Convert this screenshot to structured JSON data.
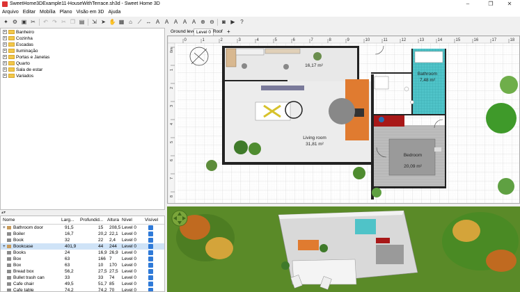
{
  "window": {
    "title": "SweetHome3DExample11-HouseWithTerrace.sh3d - Sweet Home 3D",
    "minimize": "–",
    "maximize": "❐",
    "close": "✕"
  },
  "menu": [
    "Arquivo",
    "Editar",
    "Mobília",
    "Plano",
    "Visão em 3D",
    "Ajuda"
  ],
  "catalog": {
    "categories": [
      "Banheiro",
      "Cozinha",
      "Escadas",
      "Iluminação",
      "Portas e Janelas",
      "Quarto",
      "Sala de estar",
      "Variados"
    ]
  },
  "furniture_table": {
    "columns": [
      "Nome",
      "Larg...",
      "Profundid...",
      "Altura",
      "Nível",
      "Visível"
    ],
    "rows": [
      {
        "name": "Bathroom door",
        "width": "91,5",
        "depth": "15",
        "height": "208,5",
        "level": "Level 0",
        "visible": true,
        "group": true
      },
      {
        "name": "Boiler",
        "width": "16,7",
        "depth": "20,2",
        "height": "22,1",
        "level": "Level 0",
        "visible": true
      },
      {
        "name": "Book",
        "width": "32",
        "depth": "22",
        "height": "2,4",
        "level": "Level 0",
        "visible": true
      },
      {
        "name": "Bookcase",
        "width": "401,9",
        "depth": "44",
        "height": "244",
        "level": "Level 0",
        "visible": true,
        "group": true,
        "selected": true
      },
      {
        "name": "Books",
        "width": "24",
        "depth": "16,9",
        "height": "26,9",
        "level": "Level 0",
        "visible": true
      },
      {
        "name": "Box",
        "width": "63",
        "depth": "166",
        "height": "7",
        "level": "Level 0",
        "visible": true
      },
      {
        "name": "Box",
        "width": "63",
        "depth": "10",
        "height": "170",
        "level": "Level 0",
        "visible": true
      },
      {
        "name": "Bread box",
        "width": "56,2",
        "depth": "27,5",
        "height": "27,5",
        "level": "Level 0",
        "visible": true
      },
      {
        "name": "Bullet trash can",
        "width": "33",
        "depth": "33",
        "height": "74",
        "level": "Level 0",
        "visible": true
      },
      {
        "name": "Cafe chair",
        "width": "49,5",
        "depth": "51,7",
        "height": "85",
        "level": "Level 0",
        "visible": true
      },
      {
        "name": "Cafe table",
        "width": "74,2",
        "depth": "74,2",
        "height": "70",
        "level": "Level 0",
        "visible": true
      }
    ]
  },
  "plan": {
    "tabs": [
      "Ground level",
      "Level 0",
      "Roof"
    ],
    "add_level": "+",
    "ruler_x": [
      "0",
      "1",
      "2",
      "3",
      "4",
      "5",
      "6",
      "7",
      "8",
      "9",
      "10",
      "11",
      "12",
      "13",
      "14",
      "15",
      "16",
      "17",
      "18"
    ],
    "ruler_y": [
      "0m",
      "1",
      "2",
      "3",
      "4",
      "5",
      "6",
      "7",
      "8",
      "9"
    ],
    "rooms": [
      {
        "name": "",
        "area": "16,17 m²"
      },
      {
        "name": "Bathroom",
        "area": "7,48 m²"
      },
      {
        "name": "Living room",
        "area": "31,81 m²"
      },
      {
        "name": "Bedroom",
        "area": "20,09 m²"
      }
    ]
  },
  "colors": {
    "accent": "#2f7ad8",
    "grass": "#5a8a28",
    "water": "#4fc3c8",
    "sofa": "#e07b30",
    "rug": "#a81818"
  }
}
